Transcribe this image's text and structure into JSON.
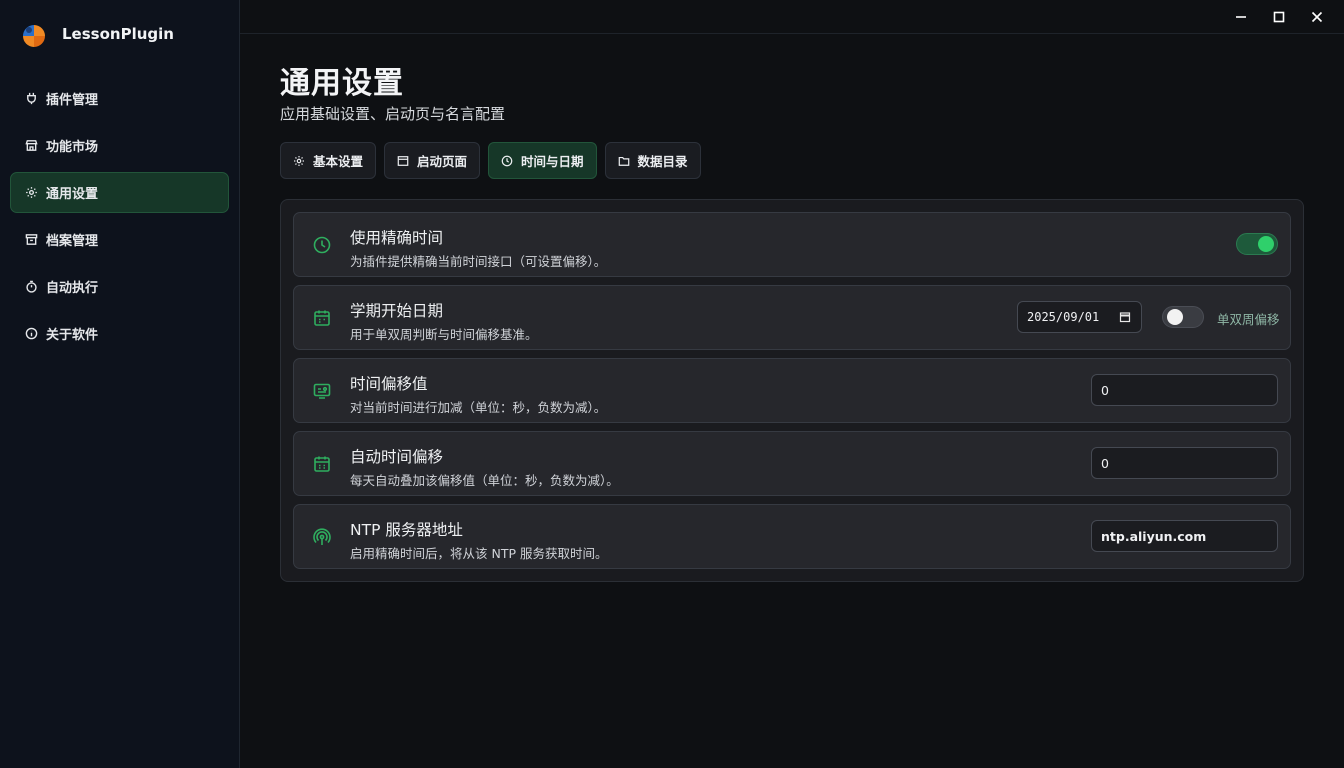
{
  "app": {
    "name": "LessonPlugin"
  },
  "sidebar": {
    "items": [
      {
        "label": "插件管理",
        "icon": "plug-icon",
        "active": false
      },
      {
        "label": "功能市场",
        "icon": "store-icon",
        "active": false
      },
      {
        "label": "通用设置",
        "icon": "gear-icon",
        "active": true
      },
      {
        "label": "档案管理",
        "icon": "archive-icon",
        "active": false
      },
      {
        "label": "自动执行",
        "icon": "timer-icon",
        "active": false
      },
      {
        "label": "关于软件",
        "icon": "info-icon",
        "active": false
      }
    ]
  },
  "window_controls": [
    "minimize-icon",
    "maximize-icon",
    "close-icon"
  ],
  "page": {
    "title": "通用设置",
    "subtitle": "应用基础设置、启动页与名言配置"
  },
  "tabs": [
    {
      "label": "基本设置",
      "icon": "gear-icon",
      "active": false
    },
    {
      "label": "启动页面",
      "icon": "window-icon",
      "active": false
    },
    {
      "label": "时间与日期",
      "icon": "clock-icon",
      "active": true
    },
    {
      "label": "数据目录",
      "icon": "folder-icon",
      "active": false
    }
  ],
  "settings": {
    "precise_time": {
      "title": "使用精确时间",
      "desc": "为插件提供精确当前时间接口（可设置偏移）。",
      "enabled": true
    },
    "term_start": {
      "title": "学期开始日期",
      "desc": "用于单双周判断与时间偏移基准。",
      "date": "2025/09/01",
      "week_toggle_label": "单双周偏移",
      "week_offset_enabled": false
    },
    "time_offset": {
      "title": "时间偏移值",
      "desc": "对当前时间进行加减（单位：秒，负数为减）。",
      "value": "0"
    },
    "auto_offset": {
      "title": "自动时间偏移",
      "desc": "每天自动叠加该偏移值（单位：秒，负数为减）。",
      "value": "0"
    },
    "ntp": {
      "title": "NTP 服务器地址",
      "desc": "启用精确时间后，将从该 NTP 服务获取时间。",
      "value": "ntp.aliyun.com"
    }
  },
  "colors": {
    "accent": "#2fd06b",
    "accent_dark": "#163728",
    "background": "#0e1013",
    "sidebar": "#0d121c"
  }
}
